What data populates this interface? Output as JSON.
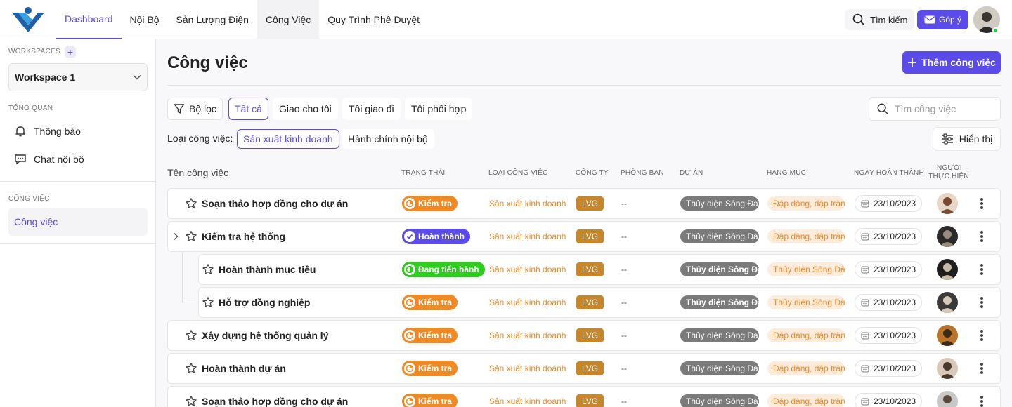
{
  "topbar": {
    "tabs": [
      {
        "label": "Dashboard",
        "active": true
      },
      {
        "label": "Nội Bộ"
      },
      {
        "label": "Sản Lượng Điện"
      },
      {
        "label": "Công Việc",
        "hover": true
      },
      {
        "label": "Quy Trình Phê Duyệt"
      }
    ],
    "search_label": "Tìm kiếm",
    "feedback_label": "Góp ý"
  },
  "sidebar": {
    "workspaces_label": "WORKSPACES",
    "workspace_name": "Workspace 1",
    "overview_label": "TỔNG QUAN",
    "overview_items": [
      {
        "label": "Thông báo",
        "icon": "bell-icon"
      },
      {
        "label": "Chat nội bộ",
        "icon": "chat-icon"
      }
    ],
    "work_label": "CÔNG VIỆC",
    "work_items": [
      {
        "label": "Công việc",
        "active": true
      }
    ]
  },
  "main": {
    "title": "Công việc",
    "add_button": "Thêm công việc",
    "filter_label": "Bộ lọc",
    "scope_chips": [
      "Tất cả",
      "Giao cho tôi",
      "Tôi giao đi",
      "Tôi phối hợp"
    ],
    "search_placeholder": "Tìm công việc",
    "type_label": "Loại công việc:",
    "type_chips": [
      "Sản xuất kinh doanh",
      "Hành chính nội bộ"
    ],
    "display_button": "Hiển thị"
  },
  "table": {
    "headers": {
      "name": "Tên công việc",
      "status": "TRẠNG THÁI",
      "type": "LOẠI CÔNG VIỆC",
      "company": "CÔNG TY",
      "department": "PHÒNG BAN",
      "project": "DỰ ÁN",
      "category": "HẠNG MỤC",
      "due_date": "NGÀY HOÀN THÀNH",
      "assignee_line1": "NGƯỜI",
      "assignee_line2": "THỰC HIỆN"
    },
    "rows": [
      {
        "name": "Soạn thảo hợp đồng cho dự án",
        "status": "Kiểm tra",
        "type": "Sản xuất kinh doanh",
        "company": "LVG",
        "department": "--",
        "project": "Thủy điện Sông Đà",
        "category": "Đập dâng, đập tràn",
        "date": "23/10/2023"
      },
      {
        "name": "Kiểm tra hệ thống",
        "status": "Hoàn thành",
        "type": "Sản xuất kinh doanh",
        "company": "LVG",
        "department": "--",
        "project": "Thủy điện Sông Đà",
        "category": "Đập dâng, đập tràn",
        "date": "23/10/2023",
        "expandable": true
      },
      {
        "name": "Hoàn thành mục tiêu",
        "status": "Đang tiến hành",
        "type": "Sản xuất kinh doanh",
        "company": "LVG",
        "department": "--",
        "project": "Thủy điện Sông Đà",
        "category": "Thủy điện Sông Đà",
        "date": "23/10/2023",
        "child": true
      },
      {
        "name": "Hỗ trợ đồng nghiệp",
        "status": "Kiểm tra",
        "type": "Sản xuất kinh doanh",
        "company": "LVG",
        "department": "--",
        "project": "Thủy điện Sông Đà",
        "category": "Thủy điện Sông Đà",
        "date": "23/10/2023",
        "child": true
      },
      {
        "name": "Xây dựng hệ thống quản lý",
        "status": "Kiểm tra",
        "type": "Sản xuất kinh doanh",
        "company": "LVG",
        "department": "--",
        "project": "Thủy điện Sông Đà",
        "category": "Đập dâng, đập tràn",
        "date": "23/10/2023"
      },
      {
        "name": "Hoàn thành dự án",
        "status": "Kiểm tra",
        "type": "Sản xuất kinh doanh",
        "company": "LVG",
        "department": "--",
        "project": "Thủy điện Sông Đà",
        "category": "Đập dâng, đập tràn",
        "date": "23/10/2023"
      },
      {
        "name": "Soạn thảo hợp đồng cho dự án",
        "status": "Kiểm tra",
        "type": "Sản xuất kinh doanh",
        "company": "LVG",
        "department": "--",
        "project": "Thủy điện Sông Đà",
        "category": "Đập dâng, đập tràn",
        "date": "23/10/2023"
      }
    ]
  },
  "colors": {
    "accent": "#5b4be8",
    "status_check": "#f08a24",
    "status_done": "#5b4be8",
    "status_progress": "#2ecc1f",
    "company": "#c8862a"
  }
}
